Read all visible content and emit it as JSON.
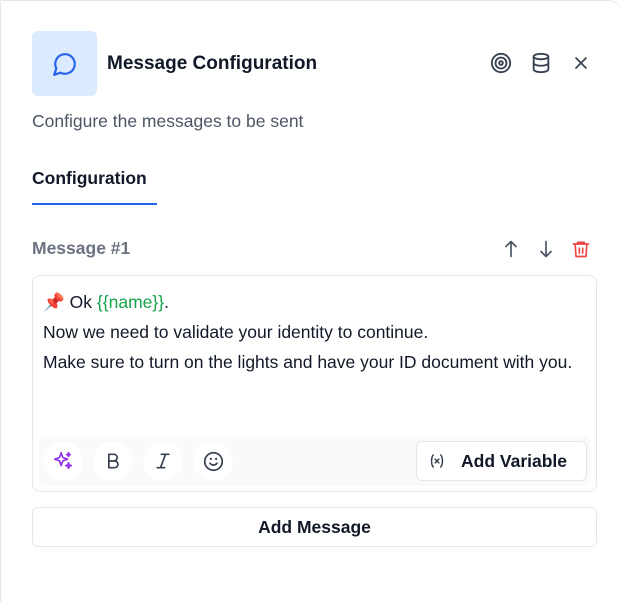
{
  "header": {
    "title": "Message Configuration",
    "subtitle": "Configure the messages to be sent",
    "icons": [
      "chat-bubble-icon",
      "target-icon",
      "database-icon",
      "close-icon"
    ],
    "accent_color": "#2563eb",
    "icon_bg_color": "#dbeafe"
  },
  "tabs": [
    {
      "label": "Configuration",
      "active": true
    }
  ],
  "message": {
    "label": "Message #1",
    "actions": [
      "move-up-icon",
      "move-down-icon",
      "trash-icon"
    ],
    "delete_color": "#ef4444",
    "lines": {
      "pin": "📌",
      "ok": "Ok",
      "variable": "{{name}}",
      "period": ".",
      "line2": "Now we need to validate your identity to continue.",
      "line3": "Make sure to turn on the lights and have your ID document with you."
    },
    "variable_color": "#16a34a"
  },
  "toolbar": {
    "tools": [
      "sparkles-icon",
      "bold-icon",
      "italic-icon",
      "emoji-icon"
    ],
    "add_variable_label": "Add Variable"
  },
  "footer": {
    "add_message_label": "Add Message"
  }
}
